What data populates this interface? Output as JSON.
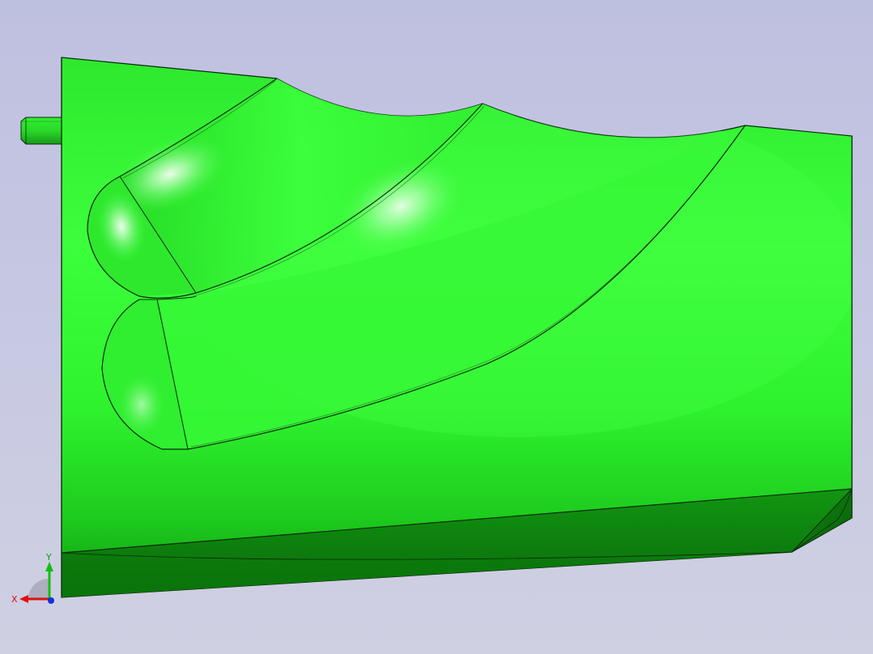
{
  "viewport": {
    "background_color": "#c6c7e2",
    "model_color": "#33ff33",
    "model_shadow_color": "#0a8c0a",
    "edge_color": "#0b2a0b"
  },
  "triad": {
    "x_label": "X",
    "y_label": "Y",
    "x_color": "#e01010",
    "y_color": "#10c010",
    "z_color": "#1030e0"
  }
}
